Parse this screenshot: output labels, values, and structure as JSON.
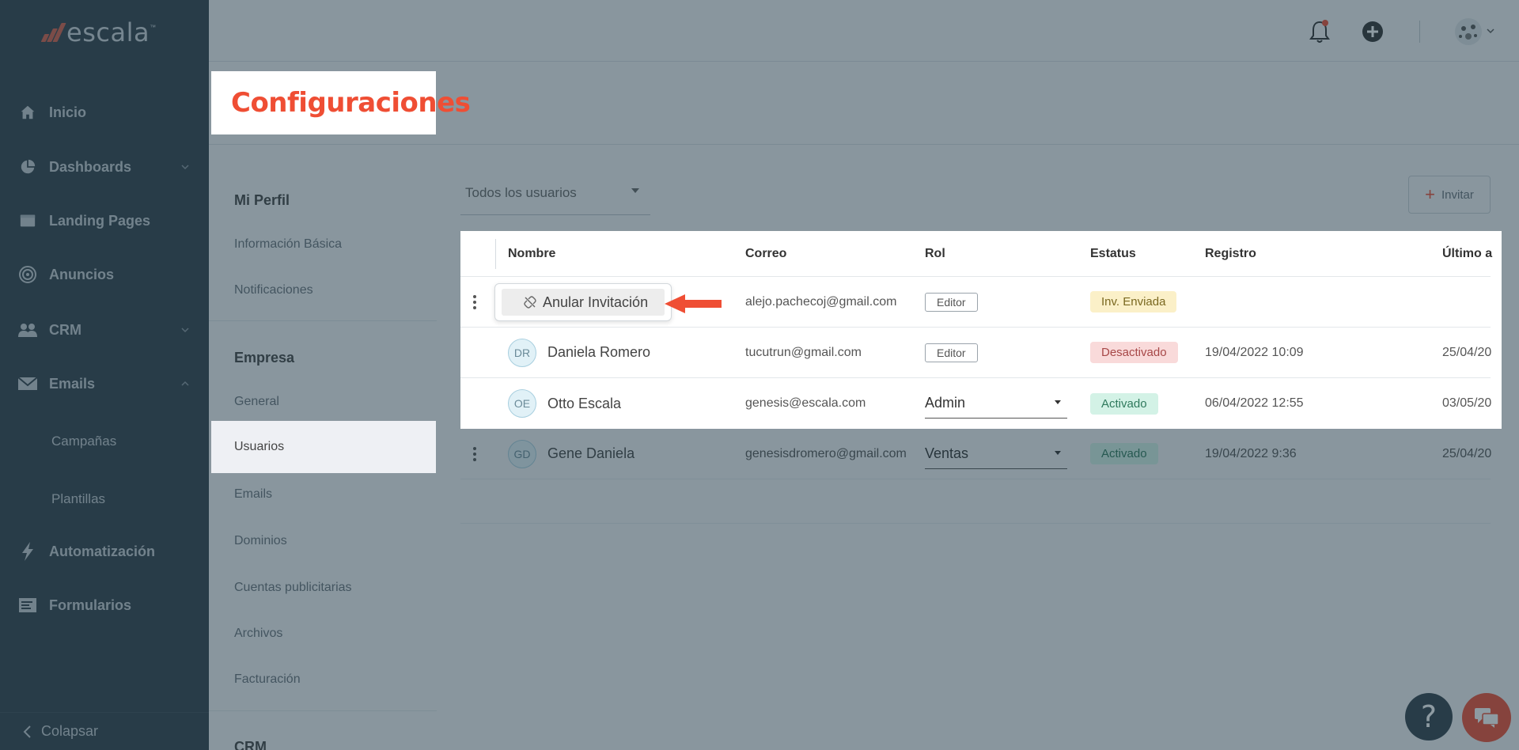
{
  "brand": {
    "name": "escala",
    "tm": "™"
  },
  "sidebar": {
    "items": [
      {
        "label": "Inicio",
        "icon": "home-icon"
      },
      {
        "label": "Dashboards",
        "icon": "pie-chart-icon"
      },
      {
        "label": "Landing Pages",
        "icon": "browser-window-icon"
      },
      {
        "label": "Anuncios",
        "icon": "target-icon"
      },
      {
        "label": "CRM",
        "icon": "users-icon"
      },
      {
        "label": "Emails",
        "icon": "envelope-icon"
      },
      {
        "label": "Automatización",
        "icon": "lightning-icon"
      },
      {
        "label": "Formularios",
        "icon": "form-icon"
      }
    ],
    "emails_sub": [
      "Campañas",
      "Plantillas"
    ],
    "collapse_label": "Colapsar"
  },
  "header": {
    "title": "Configuraciones"
  },
  "settings_nav": {
    "section1_title": "Mi Perfil",
    "section1_items": [
      "Información Básica",
      "Notificaciones"
    ],
    "section2_title": "Empresa",
    "section2_items": [
      "General",
      "Usuarios",
      "Emails",
      "Dominios",
      "Cuentas publicitarias",
      "Archivos",
      "Facturación"
    ],
    "section3_title": "CRM"
  },
  "filter": {
    "selected": "Todos los usuarios"
  },
  "invite": {
    "label": "Invitar"
  },
  "table": {
    "headers": [
      "Nombre",
      "Correo",
      "Rol",
      "Estatus",
      "Registro",
      "Último a"
    ],
    "rows": [
      {
        "initials": "",
        "name": "",
        "email": "alejo.pachecoj@gmail.com",
        "role": "Editor",
        "status": "Inv. Enviada",
        "registered": "",
        "last": ""
      },
      {
        "initials": "DR",
        "name": "Daniela Romero",
        "email": "tucutrun@gmail.com",
        "role": "Editor",
        "status": "Desactivado",
        "registered": "19/04/2022 10:09",
        "last": "25/04/20"
      },
      {
        "initials": "OE",
        "name": "Otto Escala",
        "email": "genesis@escala.com",
        "role": "Admin",
        "status": "Activado",
        "registered": "06/04/2022 12:55",
        "last": "03/05/20"
      },
      {
        "initials": "GD",
        "name": "Gene Daniela",
        "email": "genesisdromero@gmail.com",
        "role": "Ventas",
        "status": "Activado",
        "registered": "19/04/2022 9:36",
        "last": "25/04/20"
      }
    ]
  },
  "popup": {
    "label": "Anular Invitación"
  },
  "help": {
    "label": "?"
  },
  "colors": {
    "accent": "#ef4e34",
    "sidebar_bg": "#33414b"
  }
}
